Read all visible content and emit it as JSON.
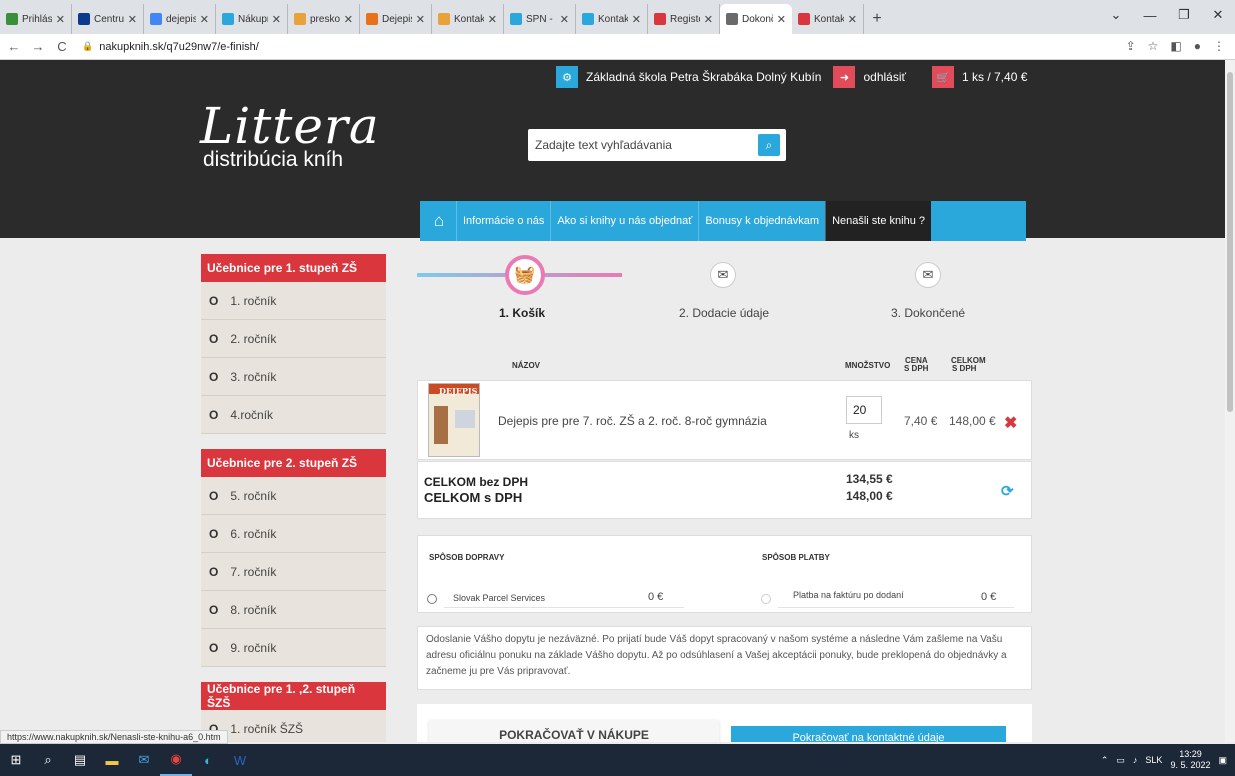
{
  "browser": {
    "tabs": [
      {
        "title": "Prihlásen",
        "color": "#3a8f3a"
      },
      {
        "title": "Centrum.",
        "color": "#0b3a8c"
      },
      {
        "title": "dejepis p",
        "color": "#4285f4"
      },
      {
        "title": "Nákupný",
        "color": "#2aa7db"
      },
      {
        "title": "preskoly.s",
        "color": "#e9a23b"
      },
      {
        "title": "Dejepis p",
        "color": "#e8711a"
      },
      {
        "title": "Kontakt |",
        "color": "#e9a23b"
      },
      {
        "title": "SPN - Mla",
        "color": "#2aa7db"
      },
      {
        "title": "Kontakty",
        "color": "#2aa7db"
      },
      {
        "title": "Register o",
        "color": "#d9363e"
      },
      {
        "title": "Dokonče",
        "color": "#6a6a6a"
      },
      {
        "title": "Kontakt",
        "color": "#d9363e"
      }
    ],
    "active_tab": 10,
    "url": "nakupknih.sk/q7u29nw7/e-finish/",
    "status_url": "https://www.nakupknih.sk/Nenasli-ste-knihu-a6_0.htm"
  },
  "header": {
    "school": "Základná škola Petra Škrabáka Dolný Kubín",
    "logout": "odhlásiť",
    "cart": "1 ks / 7,40 €",
    "logo_big": "Littera",
    "logo_small": "distribúcia kníh",
    "search_placeholder": "Zadajte text vyhľadávania"
  },
  "nav": {
    "items": [
      "Informácie o nás",
      "Ako si knihy u nás objednať",
      "Bonusy k objednávkam",
      "Nenašli ste knihu ?"
    ]
  },
  "sidebar": {
    "sections": [
      {
        "title": "Učebnice pre 1. stupeň ZŠ",
        "items": [
          "1. ročník",
          "2. ročník",
          "3. ročník",
          "4.ročník"
        ]
      },
      {
        "title": "Učebnice pre 2. stupeň ZŠ",
        "items": [
          "5. ročník",
          "6. ročník",
          "7. ročník",
          "8. ročník",
          "9. ročník"
        ]
      },
      {
        "title": "Učebnice pre 1. ,2. stupeň ŠZŠ",
        "items": [
          "1. ročník ŠZŠ"
        ]
      }
    ]
  },
  "steps": [
    "1. Košík",
    "2. Dodacie údaje",
    "3. Dokončené"
  ],
  "cart": {
    "col_name": "NÁZOV",
    "col_qty": "MNOŽSTVO",
    "col_price_1": "CENA",
    "col_price_2": "S DPH",
    "col_total_1": "CELKOM",
    "col_total_2": "S DPH",
    "book_cover_title": "DEJEPIS",
    "product": "Dejepis pre pre 7. roč. ZŠ a 2. roč. 8-roč gymnázia",
    "qty": "20",
    "unit": "ks",
    "price": "7,40 €",
    "total": "148,00 €",
    "sum_no_vat_label": "CELKOM bez DPH",
    "sum_no_vat": "134,55 €",
    "sum_vat_label": "CELKOM s DPH",
    "sum_vat": "148,00 €"
  },
  "shipping": {
    "delivery_head": "SPÔSOB DOPRAVY",
    "payment_head": "SPÔSOB PLATBY",
    "delivery_name": "Slovak Parcel Services",
    "delivery_price": "0 €",
    "payment_name": "Platba na faktúru po dodaní",
    "payment_price": "0 €"
  },
  "note": "Odoslanie Vášho dopytu je nezáväzné. Po prijatí bude Váš dopyt spracovaný v našom systéme a následne Vám zašleme na Vašu adresu oficiálnu ponuku na základe Vášho dopytu. Až po odsúhlasení a Vašej akceptácii ponuky, bude preklopená do objednávky a začneme ju pre Vás pripravovať.",
  "buttons": {
    "continue_shopping": "POKRAČOVAŤ V NÁKUPE",
    "next": "Pokračovať na kontaktné údaje"
  },
  "taskbar": {
    "lang": "SLK",
    "time": "13:29",
    "date": "9. 5. 2022"
  }
}
